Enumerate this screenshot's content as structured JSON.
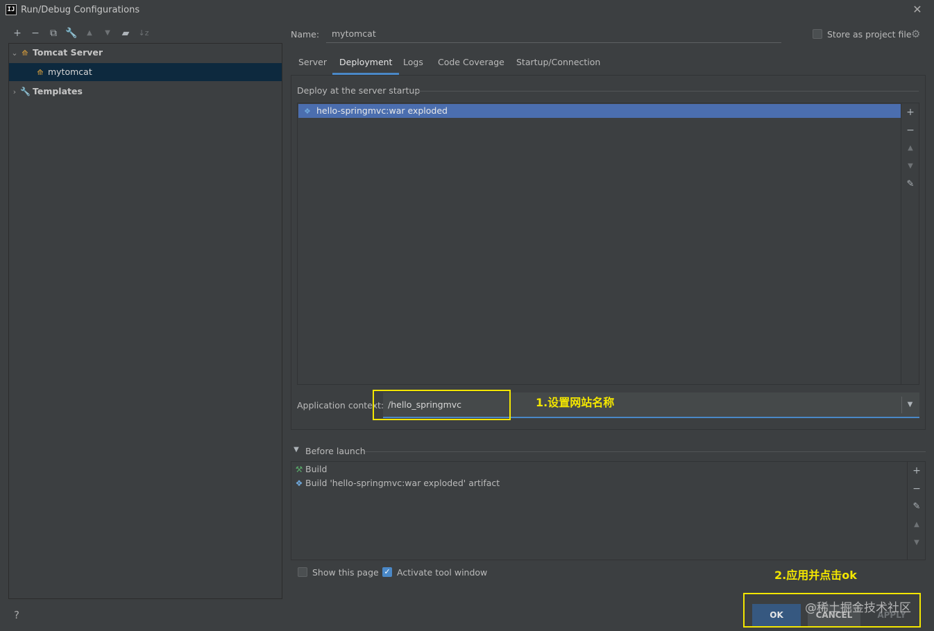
{
  "window": {
    "title": "Run/Debug Configurations",
    "logo_text": "IJ",
    "close_glyph": "✕"
  },
  "toolbar": {
    "add": "+",
    "remove": "−",
    "copy": "⧉",
    "edit": "🔧",
    "move_up": "▲",
    "move_down": "▼",
    "folder": "▰",
    "sort": "↓z"
  },
  "tree": {
    "group_label": "Tomcat Server",
    "config_label": "mytomcat",
    "templates_label": "Templates",
    "expanded_glyph": "⌄",
    "collapsed_glyph": "›"
  },
  "help_label": "?",
  "name": {
    "label": "Name:",
    "value": "mytomcat"
  },
  "store": {
    "label": "Store as project file"
  },
  "tabs": [
    {
      "label": "Server"
    },
    {
      "label": "Deployment"
    },
    {
      "label": "Logs"
    },
    {
      "label": "Code Coverage"
    },
    {
      "label": "Startup/Connection"
    }
  ],
  "deploy": {
    "title": "Deploy at the server startup",
    "items": [
      {
        "label": "hello-springmvc:war exploded"
      }
    ]
  },
  "app_context": {
    "label": "Application context:",
    "value": "/hello_springmvc"
  },
  "annotations": {
    "step1": "1.设置网站名称",
    "step2": "2.应用并点击ok"
  },
  "before_launch": {
    "title": "Before launch",
    "items": [
      {
        "label": "Build"
      },
      {
        "label": "Build 'hello-springmvc:war exploded' artifact"
      }
    ]
  },
  "checkboxes": {
    "show_page": {
      "label": "Show this page",
      "checked": false
    },
    "activate_tool": {
      "label": "Activate tool window",
      "checked": true
    }
  },
  "buttons": {
    "ok": "OK",
    "cancel": "CANCEL",
    "apply": "APPLY"
  },
  "watermark": "@稀土掘金技术社区",
  "colors": {
    "background": "#3c3f41",
    "selection": "#4b6eaf",
    "accent": "#4a88c7",
    "annotation": "#f3e600"
  }
}
